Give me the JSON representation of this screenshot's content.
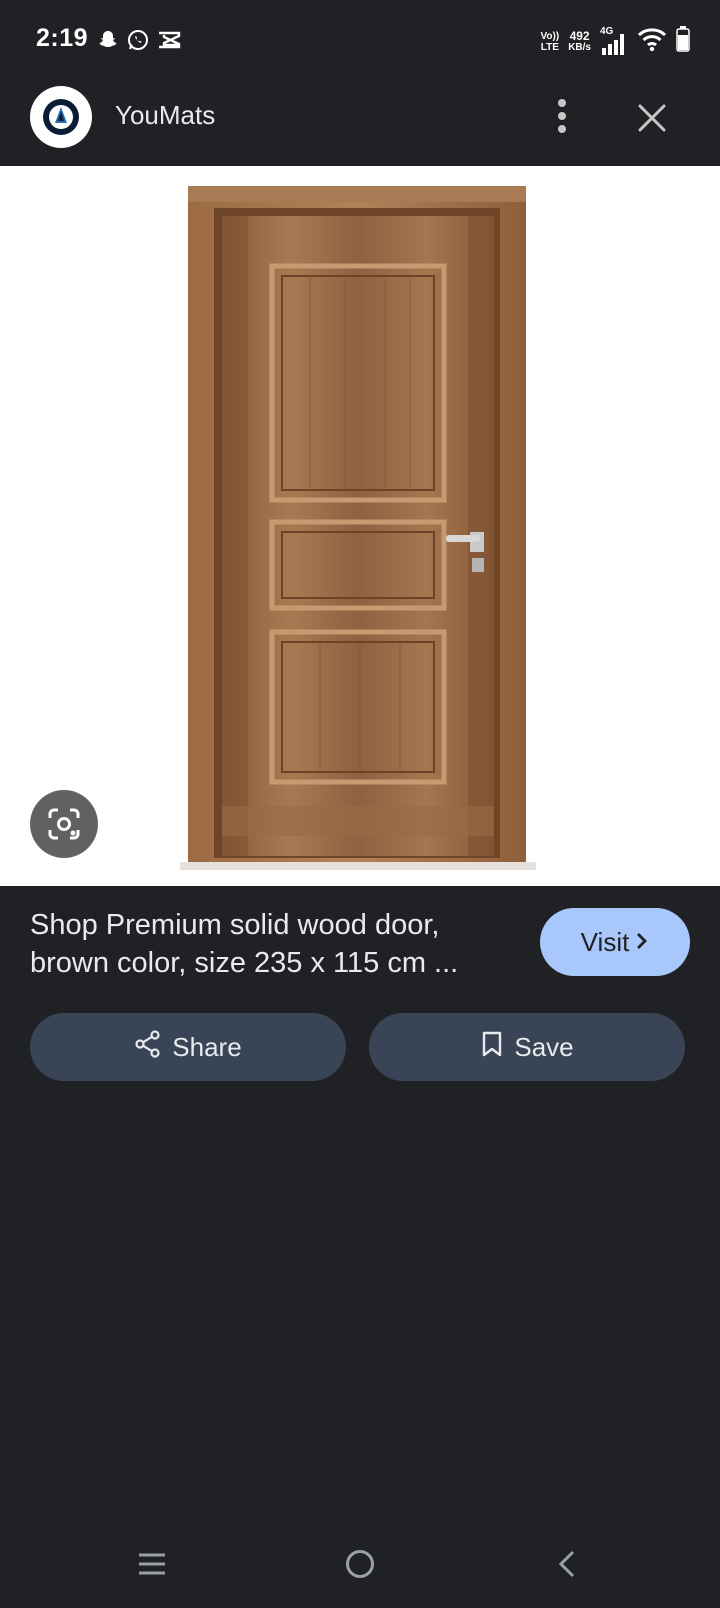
{
  "status_bar": {
    "time": "2:19",
    "volte_top": "Vo))",
    "volte_bottom": "LTE",
    "speed_value": "492",
    "speed_unit": "KB/s",
    "network": "4G",
    "icons": [
      "snapchat-icon",
      "whatsapp-icon",
      "capcut-icon",
      "signal-icon",
      "wifi-icon",
      "battery-icon"
    ]
  },
  "header": {
    "site_name": "YouMats",
    "icons": [
      "site-logo-icon",
      "more-vert-icon",
      "close-icon"
    ]
  },
  "image": {
    "subject": "door",
    "lens_icon": "google-lens-icon"
  },
  "result": {
    "title_line1": "Shop Premium solid wood door,",
    "title_line2": "brown color, size 235 x 115 cm ...",
    "visit_label": "Visit",
    "share_label": "Share",
    "save_label": "Save"
  },
  "nav": {
    "icons": [
      "recents-icon",
      "home-icon",
      "back-icon"
    ]
  },
  "colors": {
    "background": "#202124",
    "visit_button": "#a8c7fa",
    "action_button": "#394457",
    "text": "#e8eaed"
  }
}
